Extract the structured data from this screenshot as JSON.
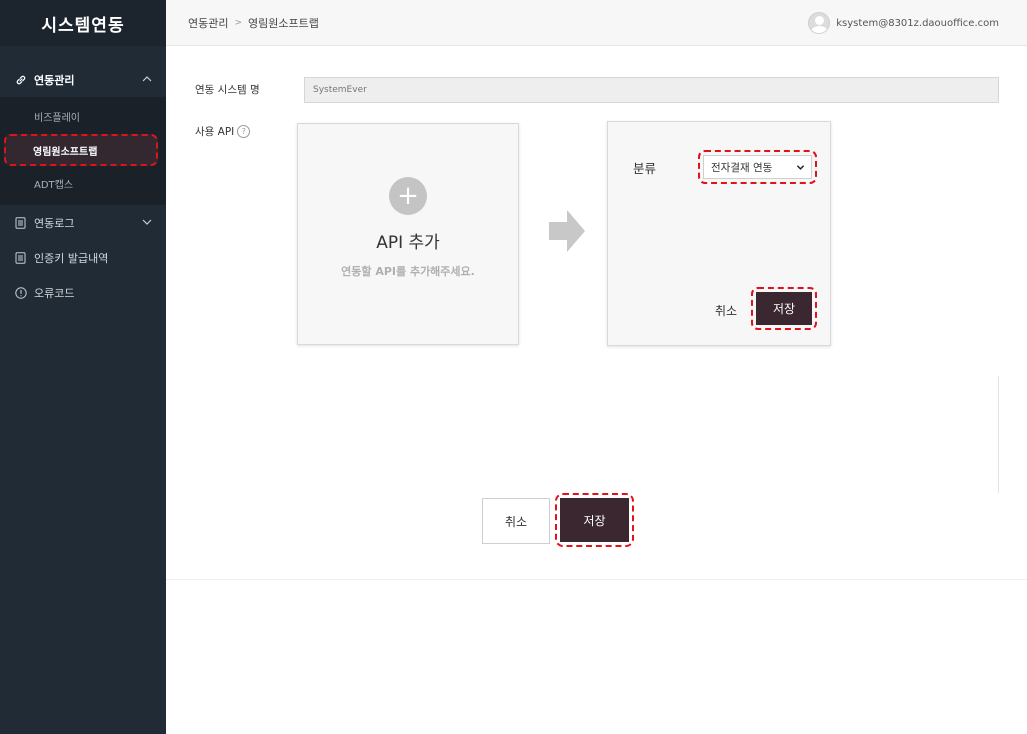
{
  "sidebar": {
    "title": "시스템연동",
    "groups": [
      {
        "label": "연동관리",
        "icon": "link-icon",
        "expanded": true,
        "items": [
          {
            "label": "비즈플레이",
            "active": false
          },
          {
            "label": "영림원소프트랩",
            "active": true
          },
          {
            "label": "ADT캡스",
            "active": false
          }
        ]
      },
      {
        "label": "연동로그",
        "icon": "document-icon",
        "expanded": false
      },
      {
        "label": "인증키 발급내역",
        "icon": "document-icon"
      },
      {
        "label": "오류코드",
        "icon": "info-circle-icon"
      }
    ]
  },
  "header": {
    "breadcrumb": [
      "연동관리",
      "영림원소프트랩"
    ],
    "breadcrumb_sep": ">",
    "user_email": "ksystem@8301z.daouoffice.com"
  },
  "form": {
    "system_name_label": "연동 시스템 명",
    "system_name_value": "SystemEver",
    "api_label": "사용 API",
    "help_symbol": "?"
  },
  "api_card": {
    "plus_symbol": "+",
    "title": "API 추가",
    "description": "연동할 API를 추가해주세요."
  },
  "config_card": {
    "category_label": "분류",
    "category_value": "전자결재 연동",
    "cancel_label": "취소",
    "save_label": "저장"
  },
  "actions": {
    "cancel_label": "취소",
    "save_label": "저장"
  },
  "colors": {
    "sidebar_bg": "#212b36",
    "accent_dark": "#3b2730",
    "highlight_red": "#e0131b"
  }
}
